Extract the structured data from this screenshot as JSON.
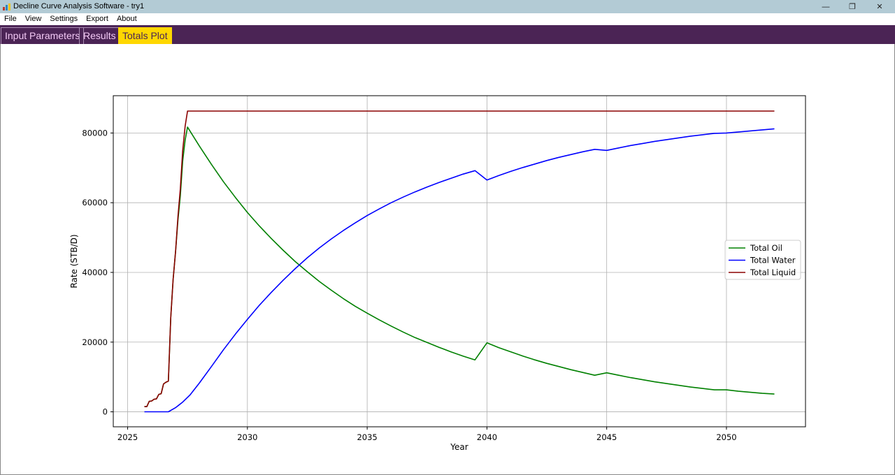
{
  "window": {
    "title": "Decline Curve Analysis Software - try1",
    "minimize_glyph": "—",
    "restore_glyph": "❐",
    "close_glyph": "✕"
  },
  "menu": {
    "items": [
      "File",
      "View",
      "Settings",
      "Export",
      "About"
    ]
  },
  "tabs": {
    "items": [
      "Input Parameters",
      "Results",
      "Totals Plot"
    ],
    "active": 2
  },
  "colors": {
    "tab_bar": "#4b2455",
    "tab_active": "#ffd700",
    "oil": "#008000",
    "water": "#0000ff",
    "liquid": "#8b0000"
  },
  "chart_data": {
    "type": "line",
    "title": "",
    "xlabel": "Year",
    "ylabel": "Rate (STB/D)",
    "xlim": [
      2024.4,
      2053.3
    ],
    "ylim": [
      -4300,
      90700
    ],
    "xticks": [
      2025,
      2030,
      2035,
      2040,
      2045,
      2050
    ],
    "yticks": [
      0,
      20000,
      40000,
      60000,
      80000
    ],
    "grid": true,
    "legend": "center-right",
    "series": [
      {
        "name": "Total Oil",
        "color": "#008000",
        "x": [
          2025.7,
          2025.8,
          2025.9,
          2026.0,
          2026.1,
          2026.2,
          2026.3,
          2026.4,
          2026.5,
          2026.6,
          2026.7,
          2026.8,
          2026.9,
          2027.0,
          2027.1,
          2027.2,
          2027.3,
          2027.4,
          2027.5,
          2028,
          2028.5,
          2029,
          2029.5,
          2030,
          2030.5,
          2031,
          2031.5,
          2032,
          2032.5,
          2033,
          2033.5,
          2034,
          2034.5,
          2035,
          2035.5,
          2036,
          2036.5,
          2037,
          2037.5,
          2038,
          2038.5,
          2039,
          2039.5,
          2040,
          2040.5,
          2041,
          2041.5,
          2042,
          2042.5,
          2043,
          2043.5,
          2044,
          2044.5,
          2045,
          2045.5,
          2046,
          2046.5,
          2047,
          2047.5,
          2048,
          2048.5,
          2049,
          2049.5,
          2050,
          2050.5,
          2051,
          2051.5,
          2052
        ],
        "values": [
          1500,
          1500,
          3000,
          3100,
          3600,
          3700,
          5000,
          5200,
          8000,
          8500,
          8800,
          27000,
          38000,
          46000,
          55000,
          62000,
          72000,
          78000,
          81700,
          76200,
          71000,
          66000,
          61500,
          57200,
          53300,
          49700,
          46300,
          43100,
          40200,
          37400,
          34900,
          32500,
          30300,
          28300,
          26400,
          24600,
          22900,
          21300,
          19900,
          18500,
          17200,
          16000,
          14900,
          19800,
          18400,
          17200,
          16000,
          14900,
          13900,
          13000,
          12100,
          11300,
          10500,
          11200,
          10500,
          9800,
          9200,
          8600,
          8100,
          7600,
          7100,
          6700,
          6300,
          6300,
          5900,
          5600,
          5300,
          5100
        ]
      },
      {
        "name": "Total Water",
        "color": "#0000ff",
        "x": [
          2025.7,
          2026.0,
          2026.5,
          2026.7,
          2027.0,
          2027.3,
          2027.6,
          2028,
          2028.5,
          2029,
          2029.5,
          2030,
          2030.5,
          2031,
          2031.5,
          2032,
          2032.5,
          2033,
          2033.5,
          2034,
          2034.5,
          2035,
          2035.5,
          2036,
          2036.5,
          2037,
          2037.5,
          2038,
          2038.5,
          2039,
          2039.5,
          2040,
          2040.5,
          2041,
          2041.5,
          2042,
          2042.5,
          2043,
          2043.5,
          2044,
          2044.5,
          2045,
          2045.5,
          2046,
          2046.5,
          2047,
          2047.5,
          2048,
          2048.5,
          2049,
          2049.5,
          2050,
          2050.5,
          2051,
          2051.5,
          2052
        ],
        "values": [
          0,
          0,
          0,
          0,
          1200,
          2800,
          4800,
          8300,
          13000,
          17800,
          22300,
          26500,
          30600,
          34300,
          37800,
          41100,
          44200,
          47000,
          49600,
          52000,
          54200,
          56300,
          58200,
          60000,
          61600,
          63100,
          64500,
          65800,
          67000,
          68200,
          69200,
          66500,
          67800,
          69000,
          70100,
          71100,
          72100,
          73000,
          73800,
          74600,
          75300,
          75000,
          75700,
          76400,
          77000,
          77600,
          78100,
          78600,
          79100,
          79500,
          79900,
          80000,
          80300,
          80600,
          80900,
          81200
        ]
      },
      {
        "name": "Total Liquid",
        "color": "#8b0000",
        "x": [
          2025.7,
          2025.8,
          2025.9,
          2026.0,
          2026.1,
          2026.2,
          2026.3,
          2026.4,
          2026.5,
          2026.6,
          2026.7,
          2026.8,
          2026.9,
          2027.0,
          2027.1,
          2027.2,
          2027.3,
          2027.4,
          2027.5,
          2030,
          2035,
          2040,
          2045,
          2050,
          2052
        ],
        "values": [
          1500,
          1500,
          3000,
          3100,
          3600,
          3700,
          5000,
          5200,
          8000,
          8500,
          8800,
          27000,
          38000,
          46000,
          56000,
          64000,
          75000,
          82000,
          86300,
          86300,
          86300,
          86300,
          86300,
          86300,
          86300
        ]
      }
    ]
  }
}
